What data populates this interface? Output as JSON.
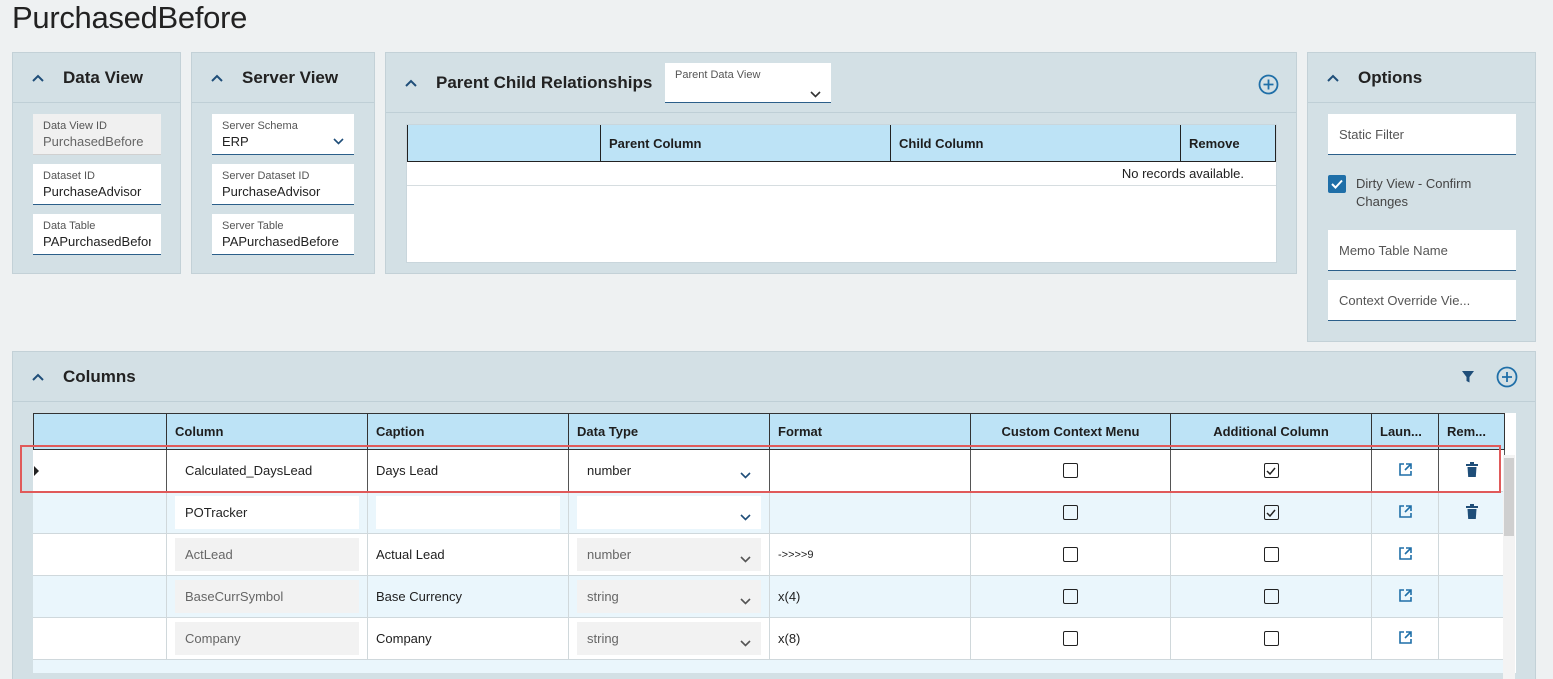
{
  "page_title": "PurchasedBefore",
  "data_view": {
    "title": "Data View",
    "fields": [
      {
        "label": "Data View ID",
        "value": "PurchasedBefore"
      },
      {
        "label": "Dataset ID",
        "value": "PurchaseAdvisor"
      },
      {
        "label": "Data Table",
        "value": "PAPurchasedBefore"
      }
    ]
  },
  "server_view": {
    "title": "Server View",
    "fields": [
      {
        "label": "Server Schema",
        "value": "ERP"
      },
      {
        "label": "Server Dataset ID",
        "value": "PurchaseAdvisor"
      },
      {
        "label": "Server Table",
        "value": "PAPurchasedBefore"
      }
    ]
  },
  "relationships": {
    "title": "Parent Child Relationships",
    "parent_data_view_label": "Parent Data View",
    "parent_data_view_value": "",
    "columns": [
      "",
      "Parent Column",
      "Child Column",
      "Remove"
    ],
    "empty_text": "No records available."
  },
  "options": {
    "title": "Options",
    "static_filter_placeholder": "Static Filter",
    "dirty_view_label": "Dirty View - Confirm Changes",
    "dirty_view_checked": true,
    "memo_table_placeholder": "Memo Table Name",
    "context_override_placeholder": "Context Override Vie..."
  },
  "columns_panel": {
    "title": "Columns",
    "headers": [
      "",
      "Column",
      "Caption",
      "Data Type",
      "Format",
      "Custom Context Menu",
      "Additional Column",
      "Laun...",
      "Rem..."
    ],
    "rows": [
      {
        "column": "Calculated_DaysLead",
        "caption": "Days Lead",
        "data_type": "number",
        "format": "",
        "custom_context_menu": false,
        "additional_column": true,
        "removable": true,
        "editable": true
      },
      {
        "column": "POTracker",
        "caption": "",
        "data_type": "",
        "format": "",
        "custom_context_menu": false,
        "additional_column": true,
        "removable": true,
        "editable": true
      },
      {
        "column": "ActLead",
        "caption": "Actual Lead",
        "data_type": "number",
        "format": "->>>>9",
        "custom_context_menu": false,
        "additional_column": false,
        "removable": false,
        "editable": false
      },
      {
        "column": "BaseCurrSymbol",
        "caption": "Base Currency",
        "data_type": "string",
        "format": "x(4)",
        "custom_context_menu": false,
        "additional_column": false,
        "removable": false,
        "editable": false
      },
      {
        "column": "Company",
        "caption": "Company",
        "data_type": "string",
        "format": "x(8)",
        "custom_context_menu": false,
        "additional_column": false,
        "removable": false,
        "editable": false
      }
    ]
  },
  "icons": {
    "collapse": "chevron-up-icon",
    "dropdown": "chevron-down-icon",
    "add": "plus-circle-icon",
    "filter": "filter-icon",
    "launch": "external-link-icon",
    "delete": "trash-icon"
  },
  "colors": {
    "panel_bg": "#d3e0e5",
    "header_bg": "#bde3f6",
    "accent": "#1f6fa8",
    "highlight": "#e05a5a"
  }
}
